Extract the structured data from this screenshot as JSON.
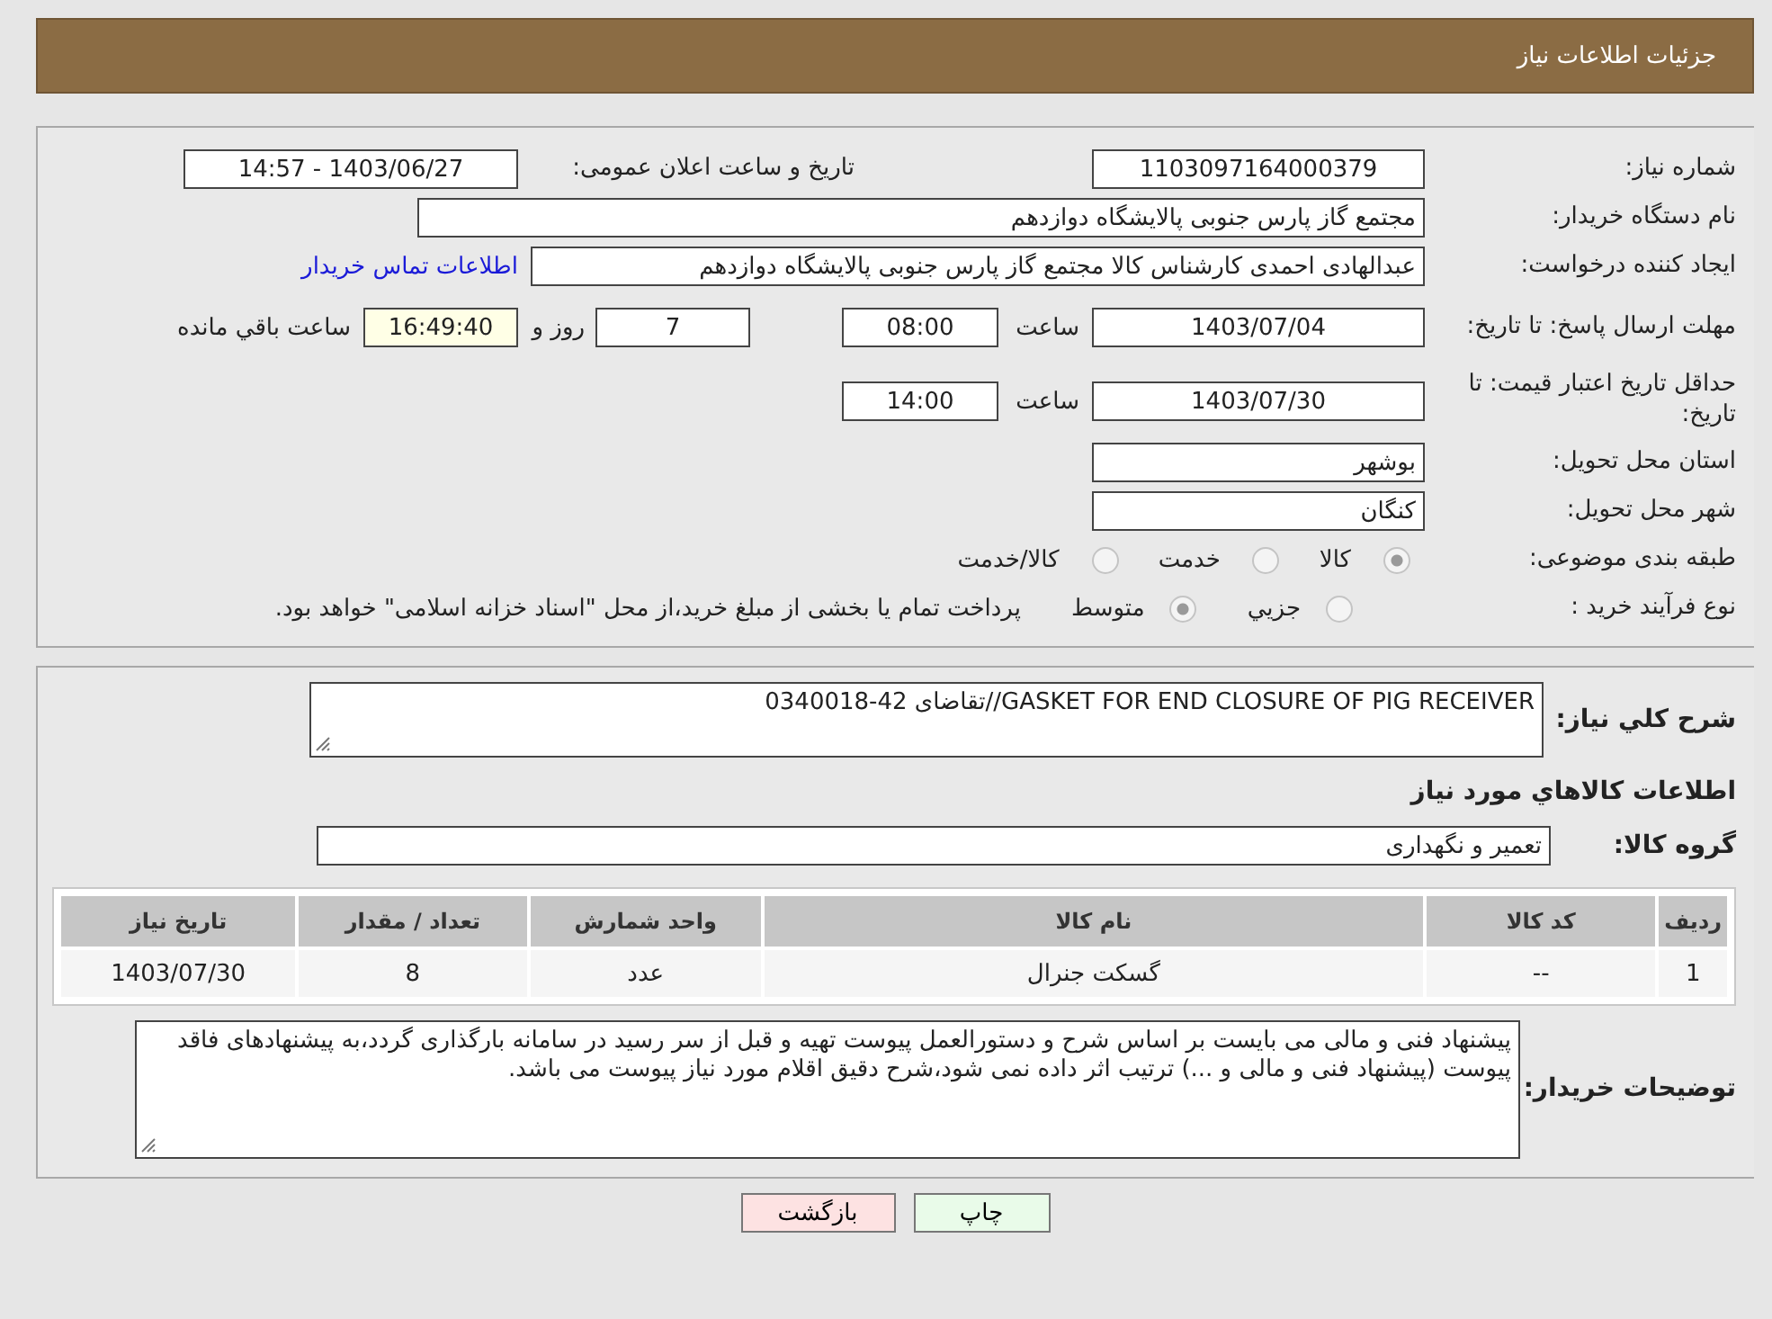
{
  "header": {
    "title": "جزئیات اطلاعات نیاز"
  },
  "need_number": {
    "label": "شماره نیاز:",
    "value": "1103097164000379"
  },
  "announce": {
    "label": "تاریخ و ساعت اعلان عمومی:",
    "value": "1403/06/27 - 14:57"
  },
  "buyer": {
    "label": "نام دستگاه خریدار:",
    "value": "مجتمع گاز پارس جنوبی  پالایشگاه دوازدهم"
  },
  "creator": {
    "label": "ایجاد کننده درخواست:",
    "value": "عبدالهادی احمدی کارشناس کالا مجتمع گاز پارس جنوبی  پالایشگاه دوازدهم",
    "link": "اطلاعات تماس خریدار"
  },
  "reply_deadline": {
    "label": "مهلت ارسال پاسخ: تا تاریخ:",
    "date": "1403/07/04",
    "time_label": "ساعت",
    "time": "08:00",
    "days": "7",
    "days_label": "روز و",
    "remaining": "16:49:40",
    "remaining_label": "ساعت باقي مانده"
  },
  "validity": {
    "label": "حداقل تاریخ اعتبار قیمت: تا تاریخ:",
    "date": "1403/07/30",
    "time_label": "ساعت",
    "time": "14:00"
  },
  "province": {
    "label": "استان محل تحویل:",
    "value": "بوشهر"
  },
  "city": {
    "label": "شهر محل تحویل:",
    "value": "کنگان"
  },
  "category": {
    "label": "طبقه بندی موضوعی:",
    "options": [
      {
        "label": "کالا",
        "selected": true
      },
      {
        "label": "خدمت",
        "selected": false
      },
      {
        "label": "کالا/خدمت",
        "selected": false
      }
    ]
  },
  "purchase_type": {
    "label": "نوع فرآیند خرید :",
    "options": [
      {
        "label": "جزيي",
        "selected": false
      },
      {
        "label": "متوسط",
        "selected": true
      }
    ],
    "note": "پرداخت تمام یا بخشی از مبلغ خرید،از محل \"اسناد خزانه اسلامی\" خواهد بود."
  },
  "description": {
    "label": "شرح کلي نیاز:",
    "value": "GASKET FOR END CLOSURE OF PIG RECEIVER//تقاضای 42-0340018"
  },
  "goods_heading": "اطلاعات کالاهاي مورد نیاز",
  "goods_group": {
    "label": "گروه کالا:",
    "value": "تعمیر و نگهداری"
  },
  "table": {
    "columns": [
      "ردیف",
      "کد کالا",
      "نام کالا",
      "واحد شمارش",
      "تعداد / مقدار",
      "تاریخ نیاز"
    ],
    "rows": [
      [
        "1",
        "--",
        "گسکت جنرال",
        "عدد",
        "8",
        "1403/07/30"
      ]
    ]
  },
  "buyer_notes": {
    "label": "توضیحات خریدار:",
    "value": "پیشنهاد فنی و مالی می بایست بر اساس شرح و دستورالعمل پیوست تهیه و قبل از سر رسید در سامانه بارگذاری گردد،به پیشنهادهای فاقد پیوست (پیشنهاد فنی و مالی و ...) ترتیب اثر داده نمی شود،شرح دقیق اقلام مورد نیاز پیوست می باشد."
  },
  "buttons": [
    {
      "label": "چاپ",
      "kind": "print"
    },
    {
      "label": "بازگشت",
      "kind": "back"
    }
  ]
}
